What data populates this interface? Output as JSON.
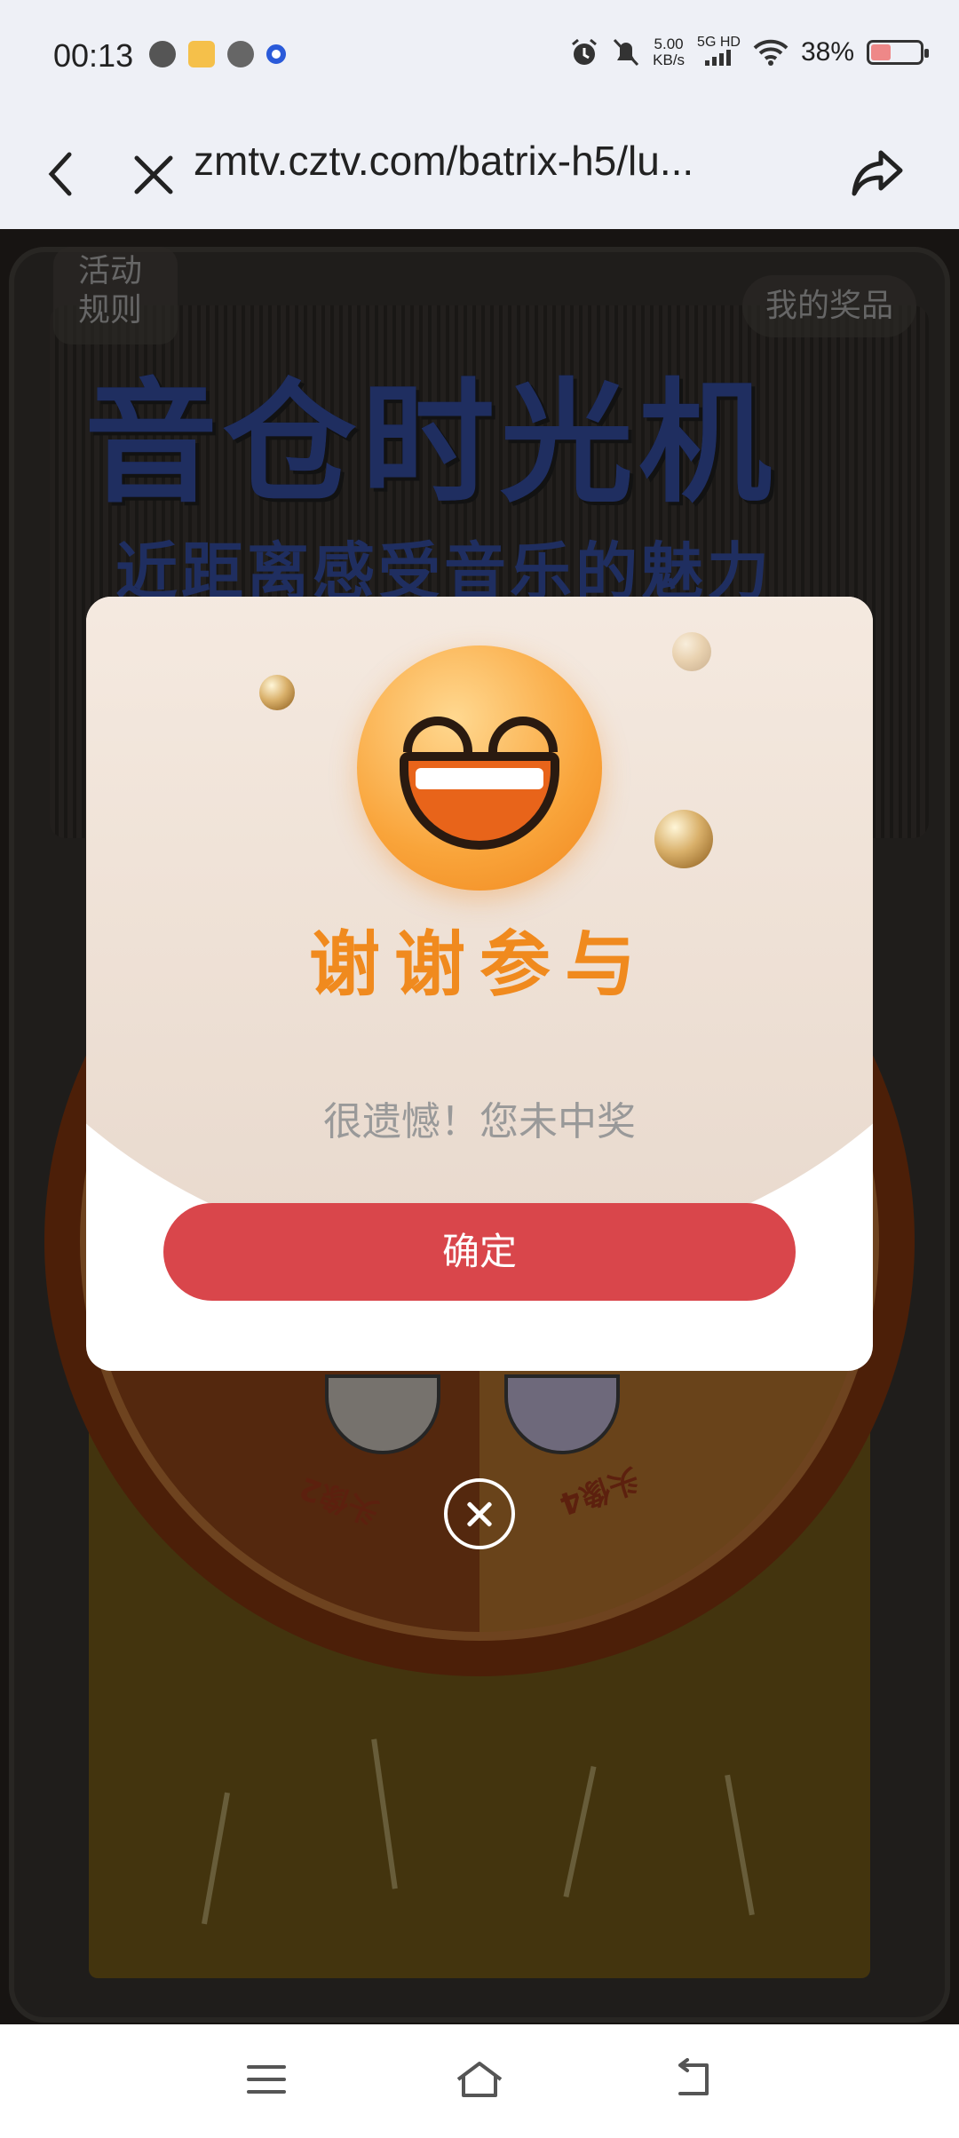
{
  "status_bar": {
    "time": "00:13",
    "net_speed_value": "5.00",
    "net_speed_unit": "KB/s",
    "network": "5G HD",
    "battery": "38%"
  },
  "address_bar": {
    "url": "zmtv.cztv.com/batrix-h5/lu..."
  },
  "page": {
    "rules_button": "活动\n规则",
    "my_prizes_button": "我的奖品",
    "title": "音仓时光机",
    "subtitle": "近距离感受音乐的魅力",
    "segment_labels": [
      "头像2",
      "头像4"
    ]
  },
  "modal": {
    "title": "谢谢参与",
    "message": "很遗憾！您未中奖",
    "confirm_label": "确定"
  },
  "colors": {
    "accent_red": "#d9464b",
    "title_orange": "#f08a1e",
    "brand_blue": "#3a54b0"
  }
}
